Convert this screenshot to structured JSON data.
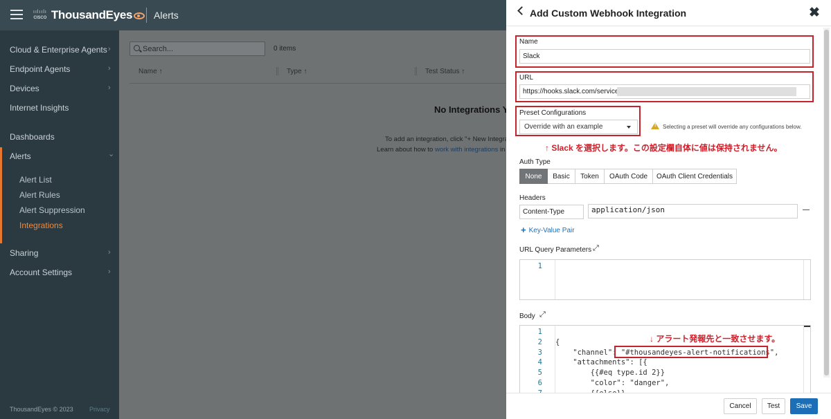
{
  "app": {
    "vendor": "CISCO",
    "brand": "ThousandEyes",
    "section": "Alerts"
  },
  "sidebar": {
    "items": [
      {
        "label": "Cloud & Enterprise Agents",
        "chevron": "›"
      },
      {
        "label": "Endpoint Agents",
        "chevron": "›"
      },
      {
        "label": "Devices",
        "chevron": "›"
      },
      {
        "label": "Internet Insights",
        "chevron": ""
      },
      {
        "label": "Dashboards",
        "chevron": ""
      },
      {
        "label": "Alerts",
        "chevron": "⌄"
      },
      {
        "label": "Sharing",
        "chevron": "›"
      },
      {
        "label": "Account Settings",
        "chevron": "›"
      }
    ],
    "alerts_sub": [
      "Alert List",
      "Alert Rules",
      "Alert Suppression",
      "Integrations"
    ],
    "active_sub": "Integrations",
    "footer": "ThousandEyes © 2023",
    "privacy": "Privacy"
  },
  "main": {
    "search_placeholder": "Search...",
    "items_count": "0 items",
    "columns": [
      "Name ↑",
      "Type ↑",
      "Test Status ↑"
    ],
    "empty_title": "No Integrations Yo",
    "empty_line1": "To add an integration, click \"+ New Integra",
    "empty_line2_prefix": "Learn about how to ",
    "empty_line2_link": "work with integrations",
    "empty_line2_suffix": " in c"
  },
  "panel": {
    "title": "Add Custom Webhook Integration",
    "name_label": "Name",
    "name_value": "Slack",
    "url_label": "URL",
    "url_value": "https://hooks.slack.com/services/",
    "preset_label": "Preset Configurations",
    "preset_value": "Override with an example",
    "preset_warning": "Selecting a preset will override any configurations below.",
    "preset_note_jp": "↑ Slack を選択します。この設定欄自体に値は保持されません。",
    "auth_label": "Auth Type",
    "auth_options": [
      "None",
      "Basic",
      "Token",
      "OAuth Code",
      "OAuth Client Credentials"
    ],
    "auth_selected": "None",
    "headers_label": "Headers",
    "header_key": "Content-Type",
    "header_value": "application/json",
    "add_kv_label": "Key-Value Pair",
    "url_query_label": "URL Query Parameters",
    "url_query_lines": [
      "1"
    ],
    "body_label": "Body",
    "body_note_jp": "↓ アラート発報先と一致させます。",
    "body_lines": [
      {
        "n": "1",
        "code": ""
      },
      {
        "n": "2",
        "code": "{"
      },
      {
        "n": "3",
        "code": "    \"channel\": \"#thousandeyes-alert-notifications\","
      },
      {
        "n": "4",
        "code": "    \"attachments\": [{"
      },
      {
        "n": "5",
        "code": "        {{#eq type.id 2}}"
      },
      {
        "n": "6",
        "code": "        \"color\": \"danger\","
      },
      {
        "n": "7",
        "code": "        {{else}}"
      }
    ],
    "buttons": {
      "cancel": "Cancel",
      "test": "Test",
      "save": "Save"
    }
  },
  "colors": {
    "accent_orange": "#e8772e",
    "highlight_red": "#c4232c",
    "primary_blue": "#1c6fb7"
  }
}
